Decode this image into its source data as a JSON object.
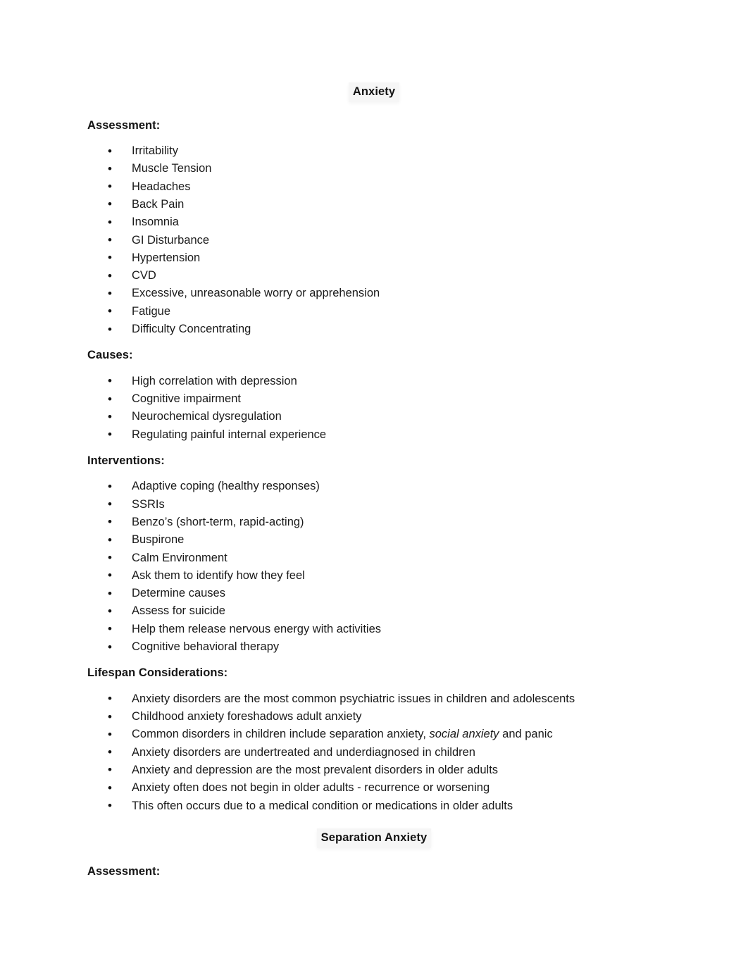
{
  "document": {
    "sections": [
      {
        "id": "anxiety",
        "title": "Anxiety",
        "groups": [
          {
            "heading": "Assessment:",
            "items": [
              "Irritability",
              "Muscle Tension",
              "Headaches",
              "Back Pain",
              "Insomnia",
              "GI Disturbance",
              "Hypertension",
              "CVD",
              "Excessive, unreasonable worry or apprehension",
              "Fatigue",
              "Difficulty Concentrating"
            ]
          },
          {
            "heading": "Causes:",
            "items": [
              "High correlation with depression",
              "Cognitive impairment",
              "Neurochemical dysregulation",
              "Regulating painful internal experience"
            ]
          },
          {
            "heading": "Interventions:",
            "items": [
              "Adaptive coping (healthy responses)",
              "SSRIs",
              "Benzo’s (short-term, rapid-acting)",
              "Buspirone",
              "Calm Environment",
              "Ask them to identify how they feel",
              "Determine causes",
              "Assess for suicide",
              "Help them release nervous energy with activities",
              "Cognitive behavioral therapy"
            ]
          },
          {
            "heading": "Lifespan Considerations:",
            "items": [
              "Anxiety disorders are the most common psychiatric issues in children and adolescents",
              "Childhood anxiety foreshadows adult anxiety",
              {
                "parts": [
                  {
                    "text": "Common disorders in children include separation anxiety, ",
                    "italic": false
                  },
                  {
                    "text": "social anxiety",
                    "italic": true
                  },
                  {
                    "text": " and panic",
                    "italic": false
                  }
                ]
              },
              "Anxiety disorders are undertreated and underdiagnosed in children",
              "Anxiety and depression are the most prevalent disorders in older adults",
              "Anxiety often does not begin in older adults - recurrence or worsening",
              "This often occurs due to a medical condition or medications in older adults"
            ]
          }
        ]
      },
      {
        "id": "separation-anxiety",
        "title": "Separation Anxiety",
        "groups": [
          {
            "heading": "Assessment:",
            "items": []
          }
        ]
      }
    ]
  }
}
